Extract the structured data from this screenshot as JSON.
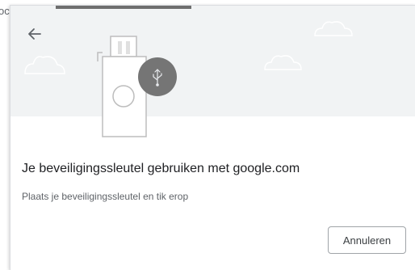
{
  "background": {
    "partial_text": "oc"
  },
  "dialog": {
    "title": "Je beveiligingssleutel gebruiken met google.com",
    "subtitle": "Plaats je beveiligingssleutel en tik erop",
    "cancel_label": "Annuleren",
    "back_icon": "arrow-back-icon",
    "illustration_icons": [
      "cloud-icon",
      "security-key-icon",
      "usb-icon"
    ],
    "colors": {
      "header_bg": "#f1f3f4",
      "progress": "#6e6e6e",
      "usb_badge": "#757575"
    }
  }
}
